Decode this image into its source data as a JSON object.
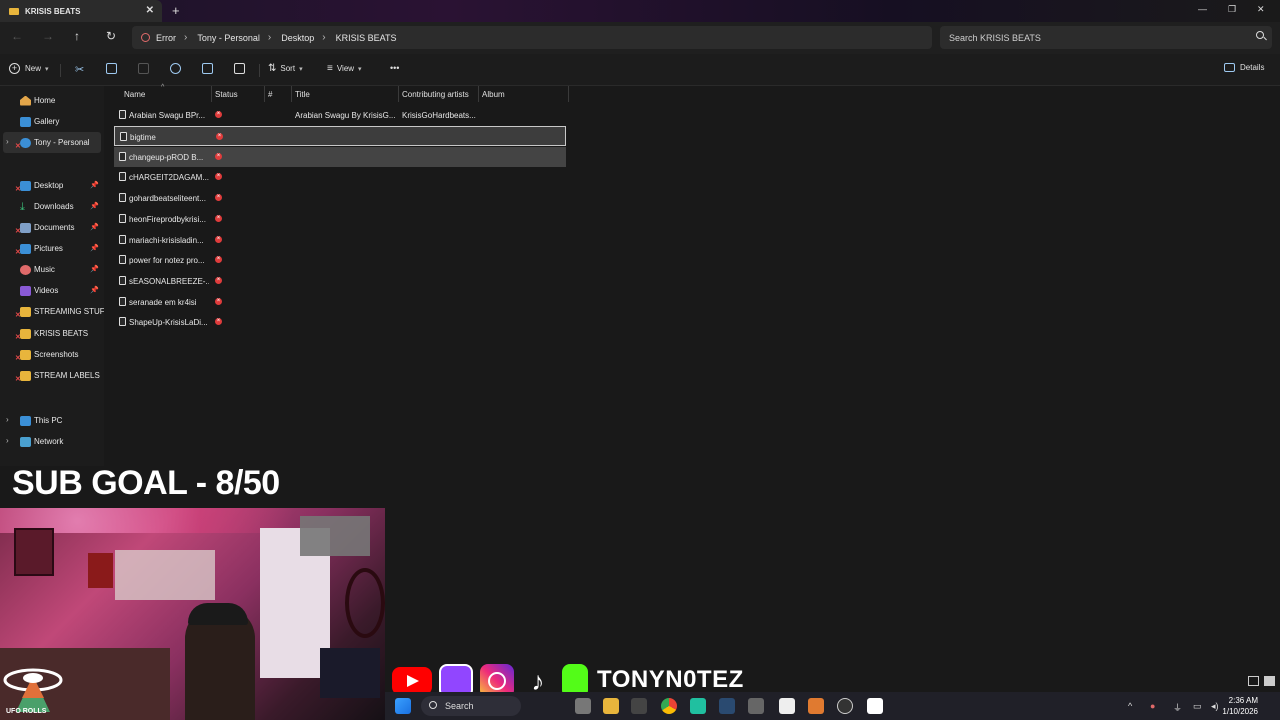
{
  "window": {
    "tab_title": "KRISIS BEATS",
    "tab_close": "✕",
    "new_tab": "+"
  },
  "address": {
    "error_label": "Error",
    "breadcrumbs": [
      "Tony - Personal",
      "Desktop",
      "KRISIS BEATS"
    ],
    "separator": "›",
    "search_placeholder": "Search KRISIS BEATS"
  },
  "toolbar": {
    "new_label": "New",
    "sort_label": "Sort",
    "view_label": "View",
    "more_label": "•••",
    "details_label": "Details"
  },
  "sidebar": {
    "items": [
      {
        "label": "Home"
      },
      {
        "label": "Gallery"
      },
      {
        "label": "Tony - Personal"
      },
      {
        "label": "Desktop"
      },
      {
        "label": "Downloads"
      },
      {
        "label": "Documents"
      },
      {
        "label": "Pictures"
      },
      {
        "label": "Music"
      },
      {
        "label": "Videos"
      },
      {
        "label": "STREAMING STUFF"
      },
      {
        "label": "KRISIS BEATS"
      },
      {
        "label": "Screenshots"
      },
      {
        "label": "STREAM LABELS"
      },
      {
        "label": "This PC"
      },
      {
        "label": "Network"
      }
    ]
  },
  "files": {
    "columns": [
      "Name",
      "Status",
      "#",
      "Title",
      "Contributing artists",
      "Album"
    ],
    "rows": [
      {
        "name": "Arabian Swagu BPr...",
        "title": "Arabian Swagu By KrisisG...",
        "artist": "KrisisGoHardbeats..."
      },
      {
        "name": "bigtime",
        "title": "",
        "artist": ""
      },
      {
        "name": "changeup-pROD B...",
        "title": "",
        "artist": ""
      },
      {
        "name": "cHARGEIT2DAGAM...",
        "title": "",
        "artist": ""
      },
      {
        "name": "gohardbeatseliteent...",
        "title": "",
        "artist": ""
      },
      {
        "name": "heonFireprodbykrisi...",
        "title": "",
        "artist": ""
      },
      {
        "name": "mariachi-krisisladin...",
        "title": "",
        "artist": ""
      },
      {
        "name": "power for notez pro...",
        "title": "",
        "artist": ""
      },
      {
        "name": "sEASONALBREEZE-...",
        "title": "",
        "artist": ""
      },
      {
        "name": "seranade em kr4isi",
        "title": "",
        "artist": ""
      },
      {
        "name": "ShapeUp-KrisisLaDi...",
        "title": "",
        "artist": ""
      }
    ]
  },
  "overlay": {
    "sub_goal": "SUB GOAL -  8/50",
    "handle": "TONYN0TEZ",
    "ufo_label": "UFO ROLLS"
  },
  "taskbar": {
    "search_label": "Search",
    "time": "2:36 AM",
    "date": "1/10/2026"
  }
}
